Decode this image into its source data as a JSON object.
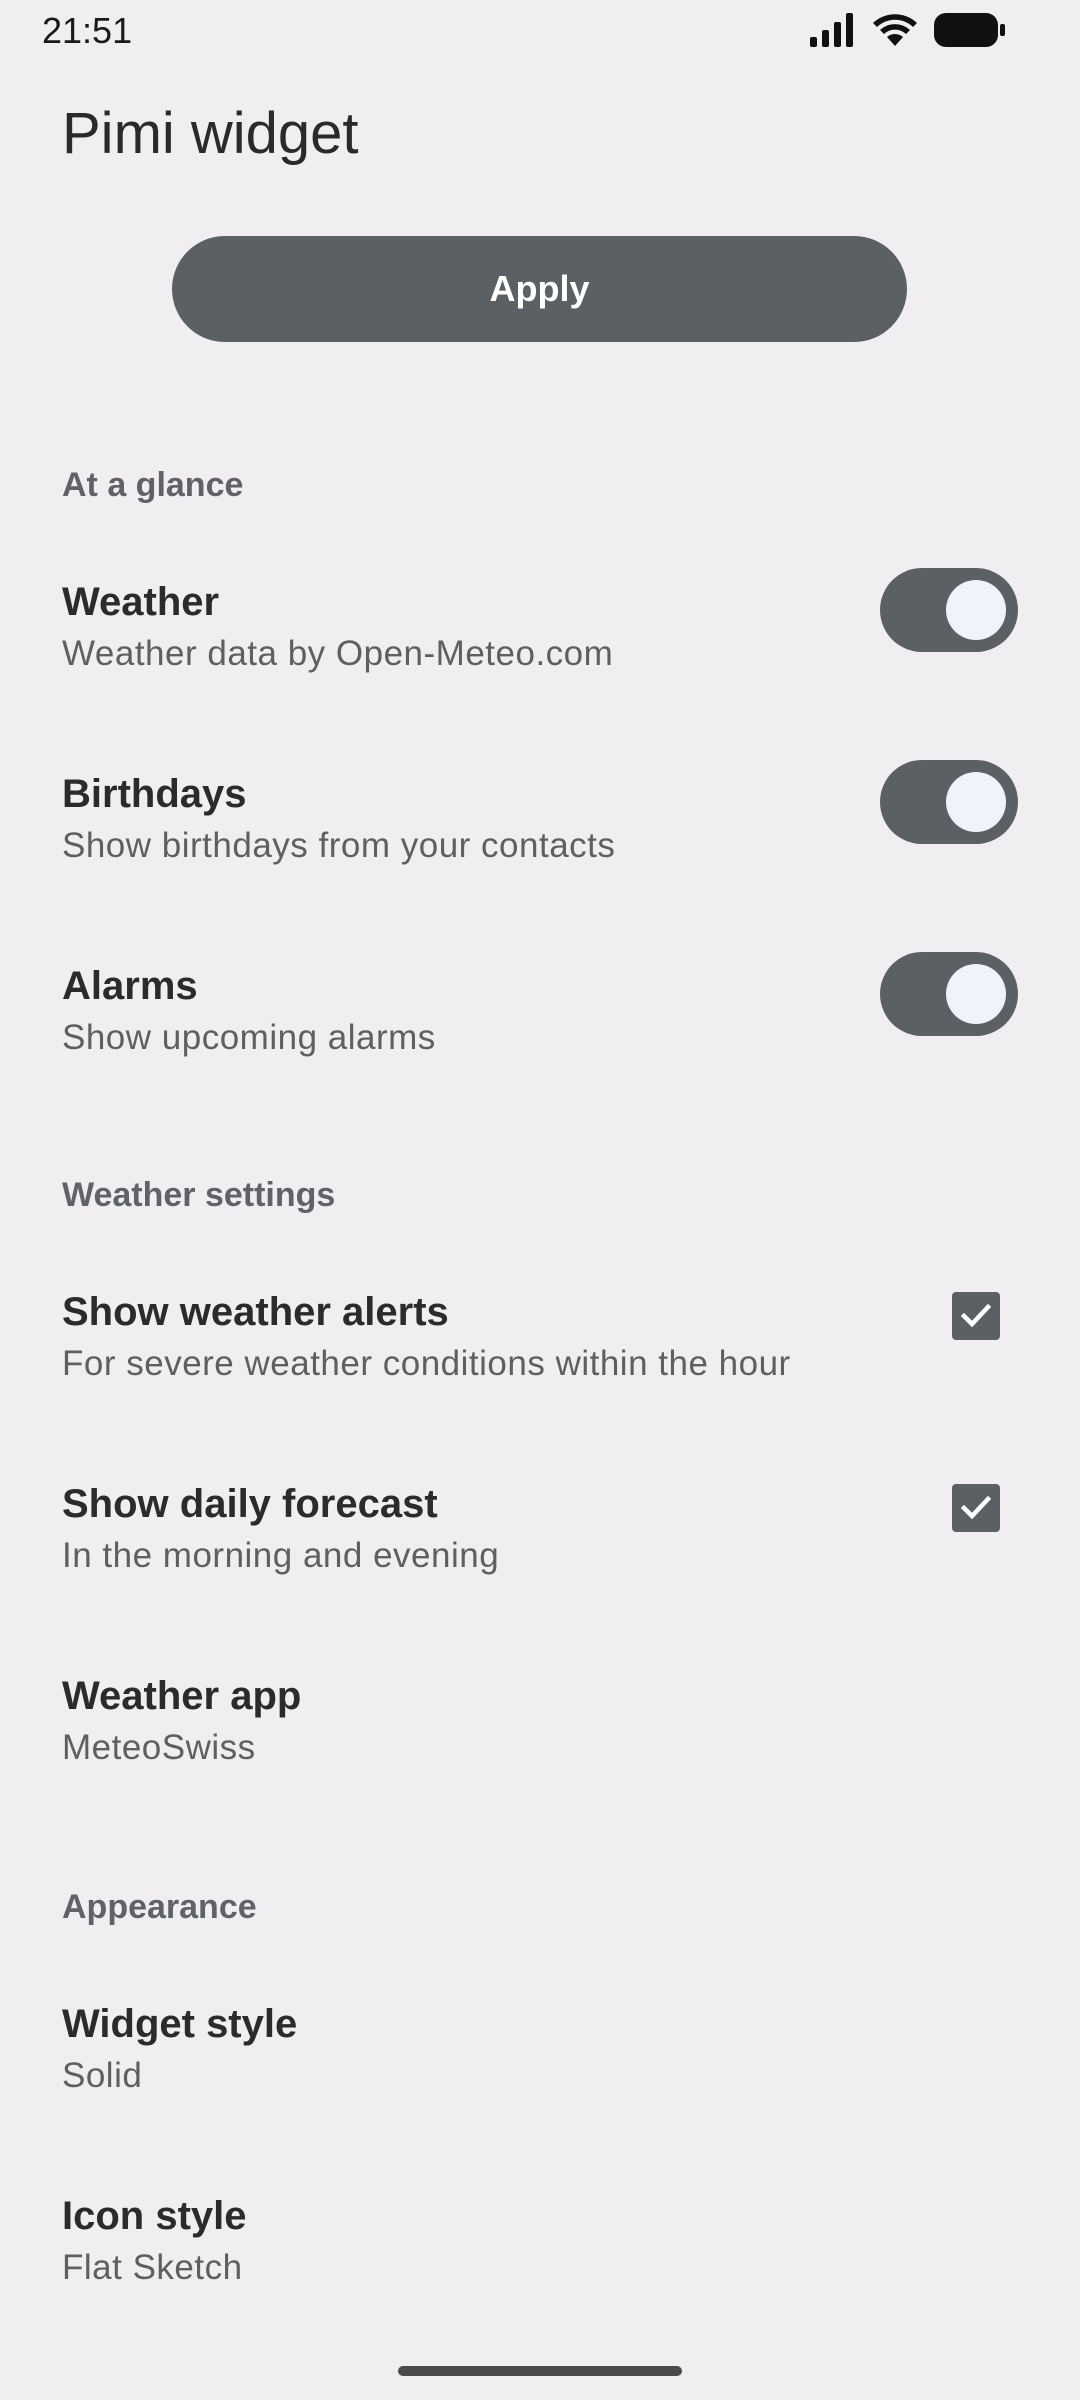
{
  "status_bar": {
    "time": "21:51"
  },
  "header": {
    "title": "Pimi widget"
  },
  "apply_label": "Apply",
  "sections": {
    "at_a_glance": "At a glance",
    "weather_settings": "Weather settings",
    "appearance": "Appearance"
  },
  "prefs": {
    "weather": {
      "title": "Weather",
      "summary": "Weather data by Open-Meteo.com",
      "checked": true
    },
    "birthdays": {
      "title": "Birthdays",
      "summary": "Show birthdays from your contacts",
      "checked": true
    },
    "alarms": {
      "title": "Alarms",
      "summary": "Show upcoming alarms",
      "checked": true
    },
    "weather_alerts": {
      "title": "Show weather alerts",
      "summary": "For severe weather conditions within the hour",
      "checked": true
    },
    "daily_forecast": {
      "title": "Show daily forecast",
      "summary": "In the morning and evening",
      "checked": true
    },
    "weather_app": {
      "title": "Weather app",
      "summary": "MeteoSwiss"
    },
    "widget_style": {
      "title": "Widget style",
      "summary": "Solid"
    },
    "icon_style": {
      "title": "Icon style",
      "summary": "Flat Sketch"
    }
  },
  "colors": {
    "background": "#f0eef0",
    "accent": "#5a6064",
    "knob": "#eef4fa"
  }
}
